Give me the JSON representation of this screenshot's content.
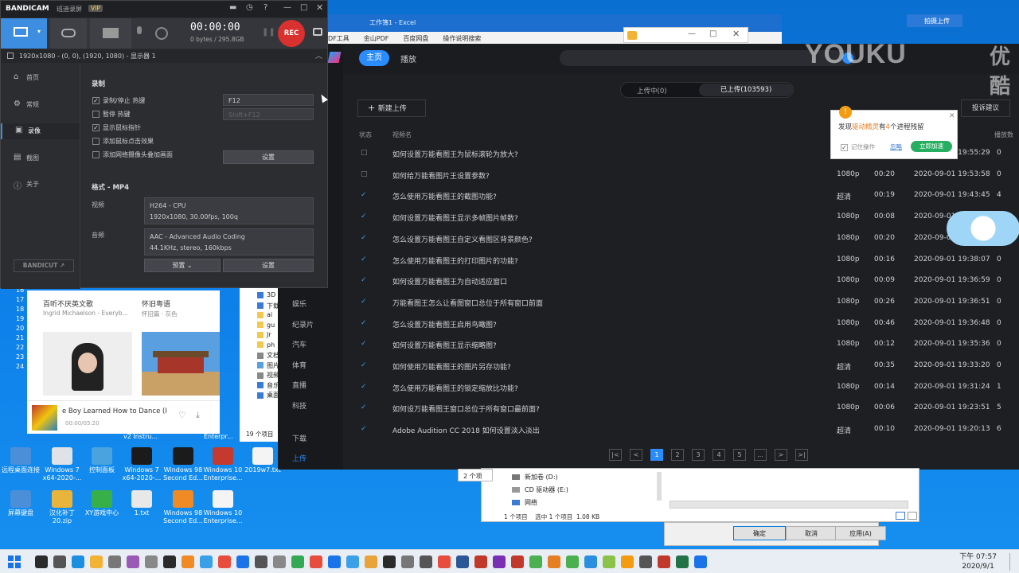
{
  "desktop_icons": [
    {
      "label": "远程桌面连接",
      "icon": "remote-desktop-icon",
      "color": "#4a8fd8"
    },
    {
      "label": "Windows 7 x64-2020-...",
      "icon": "windows-box-icon",
      "color": "#dfe3e8"
    },
    {
      "label": "控制面板",
      "icon": "control-panel-icon",
      "color": "#4aa3df"
    },
    {
      "label": "Windows 7 x64-2020-...",
      "icon": "windows-box-icon",
      "color": "#1b1b1b"
    },
    {
      "label": "Windows 98 Second Ed...",
      "icon": "windows-box-icon",
      "color": "#1b1b1b"
    },
    {
      "label": "Windows 10 Enterprise...",
      "icon": "windows-box-icon",
      "color": "#c43a2e"
    },
    {
      "label": "2019w7.txt",
      "icon": "text-file-icon",
      "color": "#f4f4f4"
    },
    {
      "label": "屏幕键盘",
      "icon": "keyboard-icon",
      "color": "#4a8fd8"
    },
    {
      "label": "汉化补丁 20.zip",
      "icon": "zip-icon",
      "color": "#e9b43a"
    },
    {
      "label": "XY游戏中心",
      "icon": "game-center-icon",
      "color": "#38b04a"
    },
    {
      "label": "1.txt",
      "icon": "text-file-icon",
      "color": "#e8e8e8"
    },
    {
      "label": "Windows 98 Second Ed...",
      "icon": "windows-box-icon",
      "color": "#f08a24"
    },
    {
      "label": "Windows 10 Enterprise...",
      "icon": "windows-box-icon",
      "color": "#f4f4f4"
    }
  ],
  "bandicam": {
    "brand": "BANDICAM",
    "subtitle": "班迪录屏",
    "vip": "VIP",
    "timer": "00:00:00",
    "size": "0 bytes / 295.8GB",
    "rec": "REC",
    "target_line": "1920x1080 - (0, 0), (1920, 1080) - 显示器 1",
    "sidebar": [
      "首页",
      "常规",
      "录像",
      "截图",
      "关于"
    ],
    "active_sidebar": "录像",
    "section_record": "录制",
    "options": [
      {
        "label": "录制/停止 热键",
        "checked": true
      },
      {
        "label": "暂停 热键",
        "checked": false
      },
      {
        "label": "显示鼠标指针",
        "checked": true
      },
      {
        "label": "添加鼠标点击效果",
        "checked": false
      },
      {
        "label": "添加网络摄像头叠加画面",
        "checked": false
      }
    ],
    "hotkey_record": "F12",
    "hotkey_pause": "Shift+F12",
    "settings_button": "设置",
    "format_title": "格式 - MP4",
    "video_label": "视频",
    "video_line1": "H264 - CPU",
    "video_line2": "1920x1080, 30.00fps, 100q",
    "audio_label": "音频",
    "audio_line1": "AAC - Advanced Audio Coding",
    "audio_line2": "44.1KHz, stereo, 160kbps",
    "preset_button": "预置",
    "settings_button2": "设置",
    "bandicut": "BANDICUT ↗"
  },
  "excel": {
    "title": "工作簿1 - Excel",
    "menu": [
      "DF工具",
      "金山PDF",
      "百度网盘",
      "操作说明搜索"
    ]
  },
  "youku": {
    "watermark": "YOUKU",
    "watermark_cn": "优酷",
    "tabs": [
      "主页",
      "播放"
    ],
    "active_tab": "主页",
    "nav_items": [
      "娱乐",
      "纪录片",
      "汽车",
      "体育",
      "直播",
      "科技",
      "下载",
      "上传"
    ],
    "active_nav": "上传",
    "segment": [
      "上传中(0)",
      "已上传(103593)"
    ],
    "active_segment": "已上传(103593)",
    "new_upload": "新建上传",
    "complaint": "投诉建议",
    "columns": {
      "status": "状态",
      "name": "视频名",
      "plays": "播放数"
    },
    "rows": [
      {
        "title": "如何设置万能看图王为鼠标滚轮为放大?",
        "quality": "",
        "duration": "",
        "date": "2020-09-01 19:55:29",
        "plays": "0"
      },
      {
        "title": "如何给万能看图片王设置参数?",
        "quality": "1080p",
        "duration": "00:20",
        "date": "2020-09-01 19:53:58",
        "plays": "0"
      },
      {
        "title": "怎么使用万能看图王的截图功能?",
        "quality": "超清",
        "duration": "00:19",
        "date": "2020-09-01 19:43:45",
        "plays": "4"
      },
      {
        "title": "如何设置万能看图王显示多帧图片帧数?",
        "quality": "1080p",
        "duration": "00:08",
        "date": "2020-09-01 19:4",
        "plays": "0"
      },
      {
        "title": "怎么设置万能看图王自定义看图区背景颜色?",
        "quality": "1080p",
        "duration": "00:20",
        "date": "2020-09-0",
        "plays": "0"
      },
      {
        "title": "怎么使用万能看图王的打印图片的功能?",
        "quality": "1080p",
        "duration": "00:16",
        "date": "2020-09-01 19:38:07",
        "plays": "0"
      },
      {
        "title": "如何设置万能看图王为自动适应窗口",
        "quality": "1080p",
        "duration": "00:09",
        "date": "2020-09-01 19:36:59",
        "plays": "0"
      },
      {
        "title": "万能看图王怎么让看图窗口总位于所有窗口前面",
        "quality": "1080p",
        "duration": "00:26",
        "date": "2020-09-01 19:36:51",
        "plays": "0"
      },
      {
        "title": "怎么设置万能看图王启用鸟瞰图?",
        "quality": "1080p",
        "duration": "00:46",
        "date": "2020-09-01 19:36:48",
        "plays": "0"
      },
      {
        "title": "如何设置万能看图王显示缩略图?",
        "quality": "1080p",
        "duration": "00:12",
        "date": "2020-09-01 19:35:36",
        "plays": "0"
      },
      {
        "title": "如何使用万能看图王的图片另存功能?",
        "quality": "超清",
        "duration": "00:35",
        "date": "2020-09-01 19:33:20",
        "plays": "0"
      },
      {
        "title": "怎么使用万能看图王的锁定缩放比功能?",
        "quality": "1080p",
        "duration": "00:14",
        "date": "2020-09-01 19:31:24",
        "plays": "1"
      },
      {
        "title": "如何设万能看图王窗口总位于所有窗口最前面?",
        "quality": "1080p",
        "duration": "00:06",
        "date": "2020-09-01 19:23:51",
        "plays": "5"
      },
      {
        "title": "Adobe Audition CC 2018 如何设置淡入淡出",
        "quality": "超清",
        "duration": "00:10",
        "date": "2020-09-01 19:20:13",
        "plays": "6"
      }
    ],
    "pages": [
      "|<",
      "<",
      "1",
      "2",
      "3",
      "4",
      "5",
      "...",
      ">",
      ">|"
    ],
    "active_page": "1",
    "popup": {
      "pre": "发现",
      "highlight": "驱动精灵",
      "mid": "有",
      "count": "4",
      "post": "个进程残留",
      "remember": "记住操作",
      "ignore": "忽略",
      "speed": "立即加速"
    },
    "upload_badge": "拍摄上传"
  },
  "music": {
    "card1_title": "百听不厌英文歌",
    "card1_sub": "Ingrid Michaelson - Everyb...",
    "card2_title": "怀旧粤语",
    "card2_sub": "怀旧篇 · 灰色",
    "now_playing": "e Boy Learned How to Dance (I",
    "time": "00:00/05:20",
    "side_numbers": [
      "16",
      "17",
      "18",
      "19",
      "20",
      "21",
      "22",
      "23",
      "24"
    ],
    "ext_lines": [
      "v2 Instru...",
      "Enterpr..."
    ]
  },
  "file_panel": {
    "items": [
      "3D",
      "下载",
      "ai",
      "gu",
      "Jr",
      "ph",
      "文档",
      "图片",
      "视频",
      "音乐",
      "桌面"
    ],
    "count": "19 个项目"
  },
  "explorer": {
    "left_count": "2 个项",
    "items": [
      "新加卷 (D:)",
      "CD 驱动器 (E:)",
      "网络"
    ],
    "status": "1 个项目    选中 1 个项目  1.08 KB"
  },
  "dialog": {
    "ok": "确定",
    "cancel": "取消",
    "apply": "应用(A)"
  },
  "clock": {
    "time": "下午 07:57",
    "date": "2020/9/1"
  },
  "taskbar_colors": [
    "#2b2b2b",
    "#555",
    "#1c8fe0",
    "#f2b233",
    "#777",
    "#9b59b6",
    "#888",
    "#2b2b2b",
    "#f08a24",
    "#3aa0e8",
    "#e74c3c",
    "#1a73e8",
    "#555",
    "#888",
    "#34a853",
    "#e74c3c",
    "#1a73e8",
    "#3aa0e8",
    "#e8a33a",
    "#2b2b2b",
    "#777",
    "#555",
    "#e74c3c",
    "#2b5797",
    "#c0392b",
    "#7b2fb5",
    "#c0392b",
    "#4caf50",
    "#e67e22",
    "#4caf50",
    "#2b8fe0",
    "#8bc34a",
    "#f39c12",
    "#555",
    "#c0392b",
    "#217346",
    "#1a73e8"
  ]
}
